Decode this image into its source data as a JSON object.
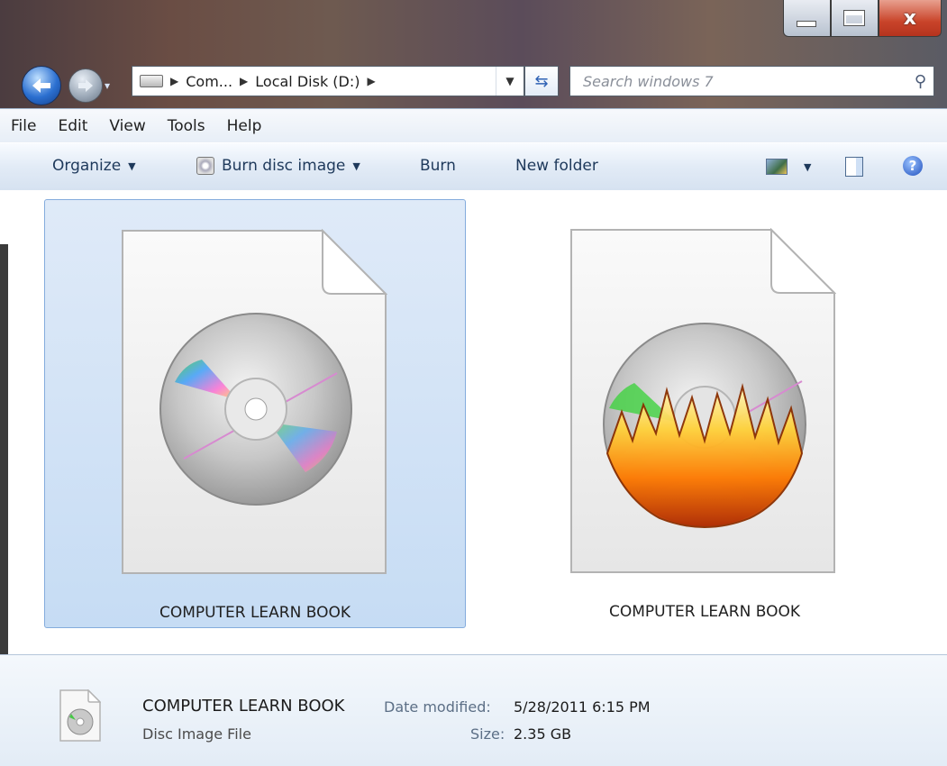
{
  "window": {
    "caption_buttons": {
      "minimize_icon": "minimize-icon",
      "maximize_icon": "maximize-icon",
      "close_glyph": "x"
    }
  },
  "navigation": {
    "back_icon": "back-arrow-icon",
    "forward_icon": "forward-arrow-icon",
    "breadcrumbs": [
      "Com...",
      "Local Disk (D:)"
    ],
    "search_placeholder": "Search windows 7"
  },
  "menubar": [
    "File",
    "Edit",
    "View",
    "Tools",
    "Help"
  ],
  "commandbar": {
    "organize": "Organize",
    "burn_disc_image": "Burn disc image",
    "burn": "Burn",
    "new_folder": "New folder"
  },
  "files": [
    {
      "name": "COMPUTER LEARN BOOK",
      "icon": "disc-image-file-icon",
      "selected": true
    },
    {
      "name": "COMPUTER LEARN BOOK",
      "icon": "burning-disc-file-icon",
      "selected": false
    }
  ],
  "details": {
    "name": "COMPUTER LEARN BOOK",
    "type": "Disc Image File",
    "date_label": "Date modified:",
    "date_value": "5/28/2011 6:15 PM",
    "size_label": "Size:",
    "size_value": "2.35 GB"
  },
  "colors": {
    "selection_bg": "#c6dcf4",
    "selection_border": "#84acdd",
    "command_text": "#1e395b",
    "detail_label": "#5c6f86"
  }
}
